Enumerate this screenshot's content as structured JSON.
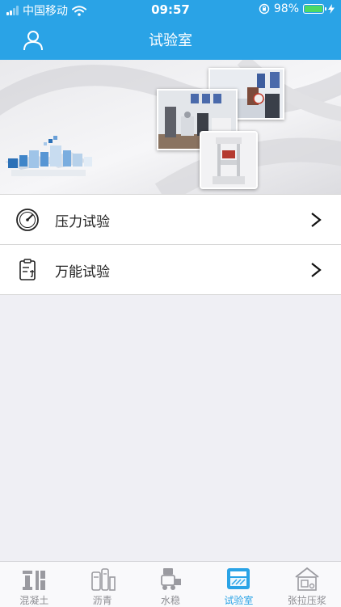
{
  "status_bar": {
    "carrier": "中国移动",
    "time": "09:57",
    "battery": "98%",
    "battery_level": 0.98
  },
  "header": {
    "title": "试验室"
  },
  "list": {
    "items": [
      {
        "label": "压力试验",
        "icon": "gauge-icon"
      },
      {
        "label": "万能试验",
        "icon": "clipboard-icon"
      }
    ]
  },
  "tabbar": {
    "tabs": [
      {
        "label": "混凝土",
        "icon": "concrete-icon",
        "active": false
      },
      {
        "label": "沥青",
        "icon": "asphalt-icon",
        "active": false
      },
      {
        "label": "水稳",
        "icon": "water-stability-icon",
        "active": false
      },
      {
        "label": "试验室",
        "icon": "laboratory-icon",
        "active": true
      },
      {
        "label": "张拉压浆",
        "icon": "tension-grouting-icon",
        "active": false
      }
    ]
  },
  "colors": {
    "brand": "#2aa3e6",
    "tab_inactive": "#8e8e93",
    "background": "#efeff4"
  }
}
